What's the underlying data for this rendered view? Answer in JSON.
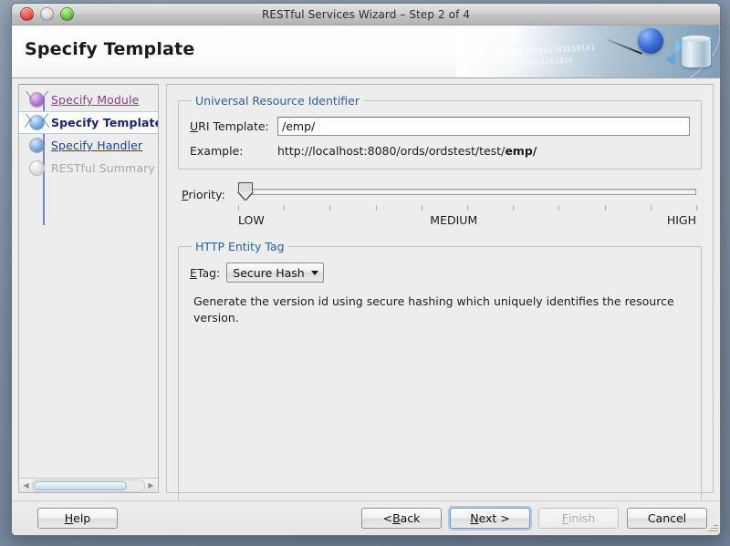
{
  "window": {
    "title": "RESTful Services Wizard – Step 2 of 4",
    "controls": {
      "close": "close",
      "minimize": "minimize",
      "maximize": "maximize"
    }
  },
  "banner": {
    "heading": "Specify Template",
    "binary_top": "01010101010101010101010101",
    "binary_bottom": "01010101010"
  },
  "sidebar": {
    "steps": [
      {
        "label": "Specify Module",
        "state": "done"
      },
      {
        "label": "Specify Template",
        "state": "current"
      },
      {
        "label": "Specify Handler",
        "state": "next"
      },
      {
        "label": "RESTful Summary",
        "state": "disabled"
      }
    ]
  },
  "uri_group": {
    "legend": "Universal Resource Identifier",
    "template_label_mnemonic": "U",
    "template_label_rest": "RI Template:",
    "template_value": "/emp/",
    "template_placeholder": "",
    "example_label": "Example:",
    "example_prefix": "http://localhost:8080/ords/ordstest/test/",
    "example_bold": "emp/"
  },
  "priority": {
    "label_mnemonic": "P",
    "label_rest": "riority:",
    "value": 0,
    "min": 0,
    "max": 100,
    "tick_count": 10,
    "scale_low": "LOW",
    "scale_medium": "MEDIUM",
    "scale_high": "HIGH"
  },
  "etag_group": {
    "legend": "HTTP Entity Tag",
    "label_mnemonic": "E",
    "label_rest": "Tag:",
    "selected": "Secure Hash",
    "options": [
      "Secure Hash"
    ],
    "description": "Generate the version id using secure hashing which uniquely identifies the resource version."
  },
  "footer": {
    "help": {
      "mnemonic": "H",
      "rest": "elp"
    },
    "back": {
      "prefix": "< ",
      "mnemonic": "B",
      "rest": "ack"
    },
    "next": {
      "mnemonic": "N",
      "rest": "ext >"
    },
    "finish": {
      "mnemonic": "F",
      "rest": "inish",
      "disabled": true
    },
    "cancel": {
      "label": "Cancel"
    }
  },
  "colors": {
    "accent_blue": "#2b5f9e",
    "link_blue": "#1c3fa0",
    "visited_purple": "#8a3d95",
    "disabled_gray": "#a8a8a8",
    "focus_ring": "#a9cbe8"
  }
}
